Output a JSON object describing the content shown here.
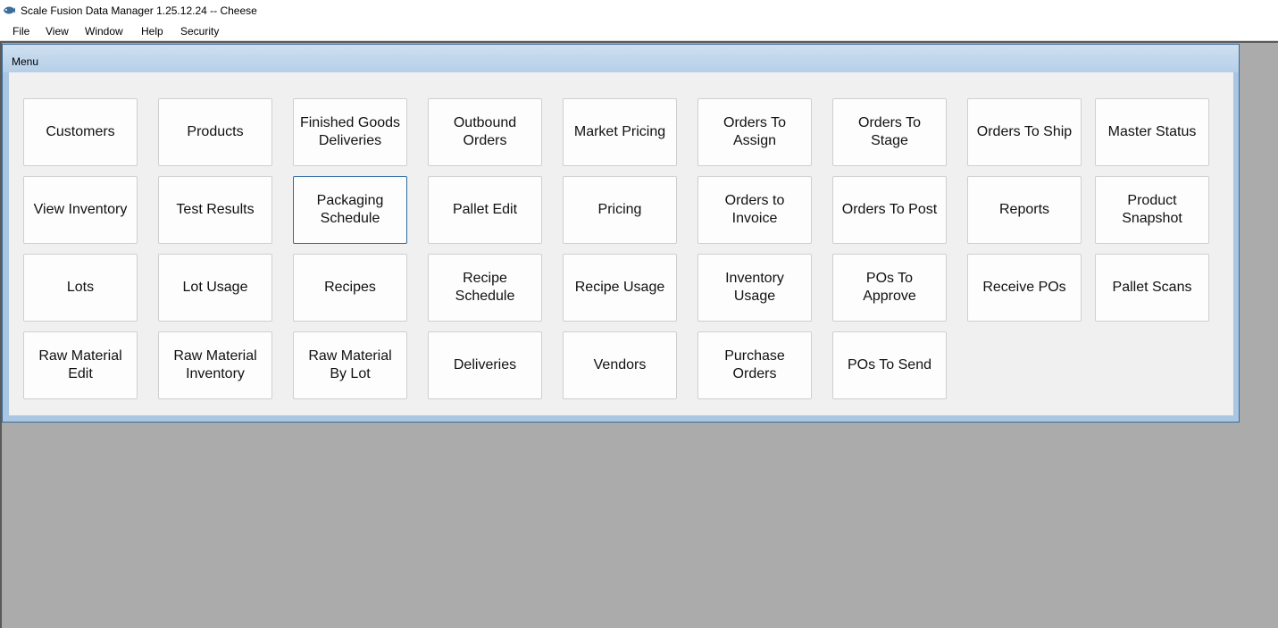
{
  "window": {
    "title": "Scale Fusion Data Manager 1.25.12.24 -- Cheese",
    "icon": "app-fish-icon"
  },
  "menubar": {
    "file": "File",
    "view": "View",
    "window": "Window",
    "help": "Help",
    "security": "Security"
  },
  "mdi": {
    "caption": "Menu"
  },
  "tiles": {
    "customers": "Customers",
    "products": "Products",
    "finished_goods_deliveries": "Finished Goods\nDeliveries",
    "outbound_orders": "Outbound\nOrders",
    "market_pricing": "Market Pricing",
    "orders_to_assign": "Orders To\nAssign",
    "orders_to_stage": "Orders To\nStage",
    "orders_to_ship": "Orders To Ship",
    "master_status": "Master Status",
    "view_inventory": "View Inventory",
    "test_results": "Test Results",
    "packaging_schedule": "Packaging\nSchedule",
    "pallet_edit": "Pallet Edit",
    "pricing": "Pricing",
    "orders_to_invoice": "Orders to\nInvoice",
    "orders_to_post": "Orders To Post",
    "reports": "Reports",
    "product_snapshot": "Product\nSnapshot",
    "lots": "Lots",
    "lot_usage": "Lot Usage",
    "recipes": "Recipes",
    "recipe_schedule": "Recipe\nSchedule",
    "recipe_usage": "Recipe Usage",
    "inventory_usage": "Inventory\nUsage",
    "pos_to_approve": "POs To\nApprove",
    "receive_pos": "Receive POs",
    "pallet_scans": "Pallet Scans",
    "raw_material_edit": "Raw Material\nEdit",
    "raw_material_inventory": "Raw Material\nInventory",
    "raw_material_by_lot": "Raw Material\nBy Lot",
    "deliveries": "Deliveries",
    "vendors": "Vendors",
    "purchase_orders": "Purchase\nOrders",
    "pos_to_send": "POs To Send"
  },
  "focused_tile": "packaging_schedule",
  "colors": {
    "desktop": "#ababab",
    "caption": "#b5cfe8",
    "focus_border": "#2f6aa3"
  }
}
